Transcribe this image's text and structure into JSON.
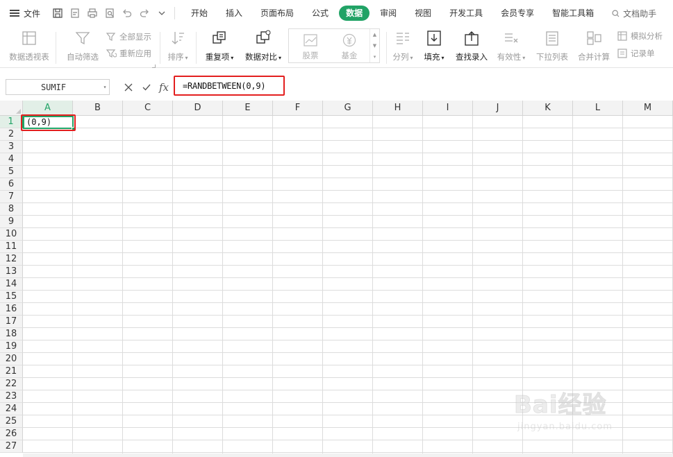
{
  "menubar": {
    "file_label": "文件",
    "tabs": [
      "开始",
      "插入",
      "页面布局",
      "公式",
      "数据",
      "审阅",
      "视图",
      "开发工具",
      "会员专享",
      "智能工具箱"
    ],
    "active_tab": "数据",
    "assistant": "文档助手",
    "accent_color": "#21a366"
  },
  "ribbon": {
    "pivot": "数据透视表",
    "autofilter": "自动筛选",
    "show_all": "全部显示",
    "reapply": "重新应用",
    "sort": "排序",
    "duplicates": "重复项",
    "compare": "数据对比",
    "stocks": "股票",
    "funds": "基金",
    "split": "分列",
    "fill": "填充",
    "lookup_entry": "查找录入",
    "validity": "有效性",
    "dropdown_list": "下拉列表",
    "consolidate": "合并计算",
    "what_if": "模拟分析",
    "record_sheet": "记录单"
  },
  "formula_bar": {
    "name_box": "SUMIF",
    "fx": "fx",
    "formula": "=RANDBETWEEN(0,9)",
    "highlight_color": "#e31e1e"
  },
  "sheet": {
    "columns": [
      "A",
      "B",
      "C",
      "D",
      "E",
      "F",
      "G",
      "H",
      "I",
      "J",
      "K",
      "L",
      "M"
    ],
    "rows": [
      "1",
      "2",
      "3",
      "4",
      "5",
      "6",
      "7",
      "8",
      "9",
      "10",
      "11",
      "12",
      "13",
      "14",
      "15",
      "16",
      "17",
      "18",
      "19",
      "20",
      "21",
      "22",
      "23",
      "24",
      "25",
      "26",
      "27"
    ],
    "active_cell": "A1",
    "cell_a1": "(0,9)"
  },
  "watermark": {
    "brand": "Bai经验",
    "url": "jingyan.baidu.com"
  }
}
